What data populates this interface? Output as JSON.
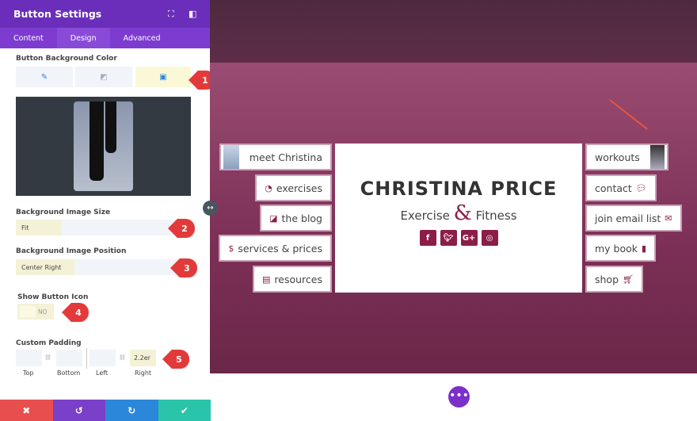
{
  "panel": {
    "title": "Button Settings",
    "header_icons": [
      "fullscreen-icon",
      "sidebar-toggle-icon"
    ],
    "tabs": [
      {
        "label": "Content"
      },
      {
        "label": "Design",
        "active": true
      },
      {
        "label": "Advanced"
      }
    ],
    "bg_color_label": "Button Background Color",
    "bg_types": [
      "color-icon",
      "gradient-icon",
      "image-icon"
    ],
    "bg_active": "image",
    "bg_size_label": "Background Image Size",
    "bg_size_value": "Fit",
    "bg_position_label": "Background Image Position",
    "bg_position_value": "Center Right",
    "show_icon_label": "Show Button Icon",
    "show_icon_value": "NO",
    "padding_label": "Custom Padding",
    "padding": {
      "top": "",
      "bottom": "",
      "left": "",
      "right": "2.2er"
    },
    "padding_labels": {
      "top": "Top",
      "bottom": "Bottom",
      "left": "Left",
      "right": "Right"
    },
    "markers": [
      "1",
      "2",
      "3",
      "4",
      "5"
    ],
    "footer_colors": {
      "cancel": "#e84e4e",
      "undo": "#7b40c9",
      "redo": "#2b87da",
      "save": "#29c4a9"
    }
  },
  "site": {
    "title": "CHRISTINA PRICE",
    "subtitle_left": "Exercise",
    "ampersand": "&",
    "subtitle_right": "Fitness",
    "social": [
      "f",
      "t",
      "G+",
      "ig"
    ],
    "left_buttons": [
      {
        "label": "meet Christina"
      },
      {
        "label": "exercises"
      },
      {
        "label": "the blog"
      },
      {
        "label": "services & prices"
      },
      {
        "label": "resources"
      }
    ],
    "right_buttons": [
      {
        "label": "workouts"
      },
      {
        "label": "contact"
      },
      {
        "label": "join email list"
      },
      {
        "label": "my book"
      },
      {
        "label": "shop"
      }
    ],
    "accent": "#8c1d48"
  }
}
